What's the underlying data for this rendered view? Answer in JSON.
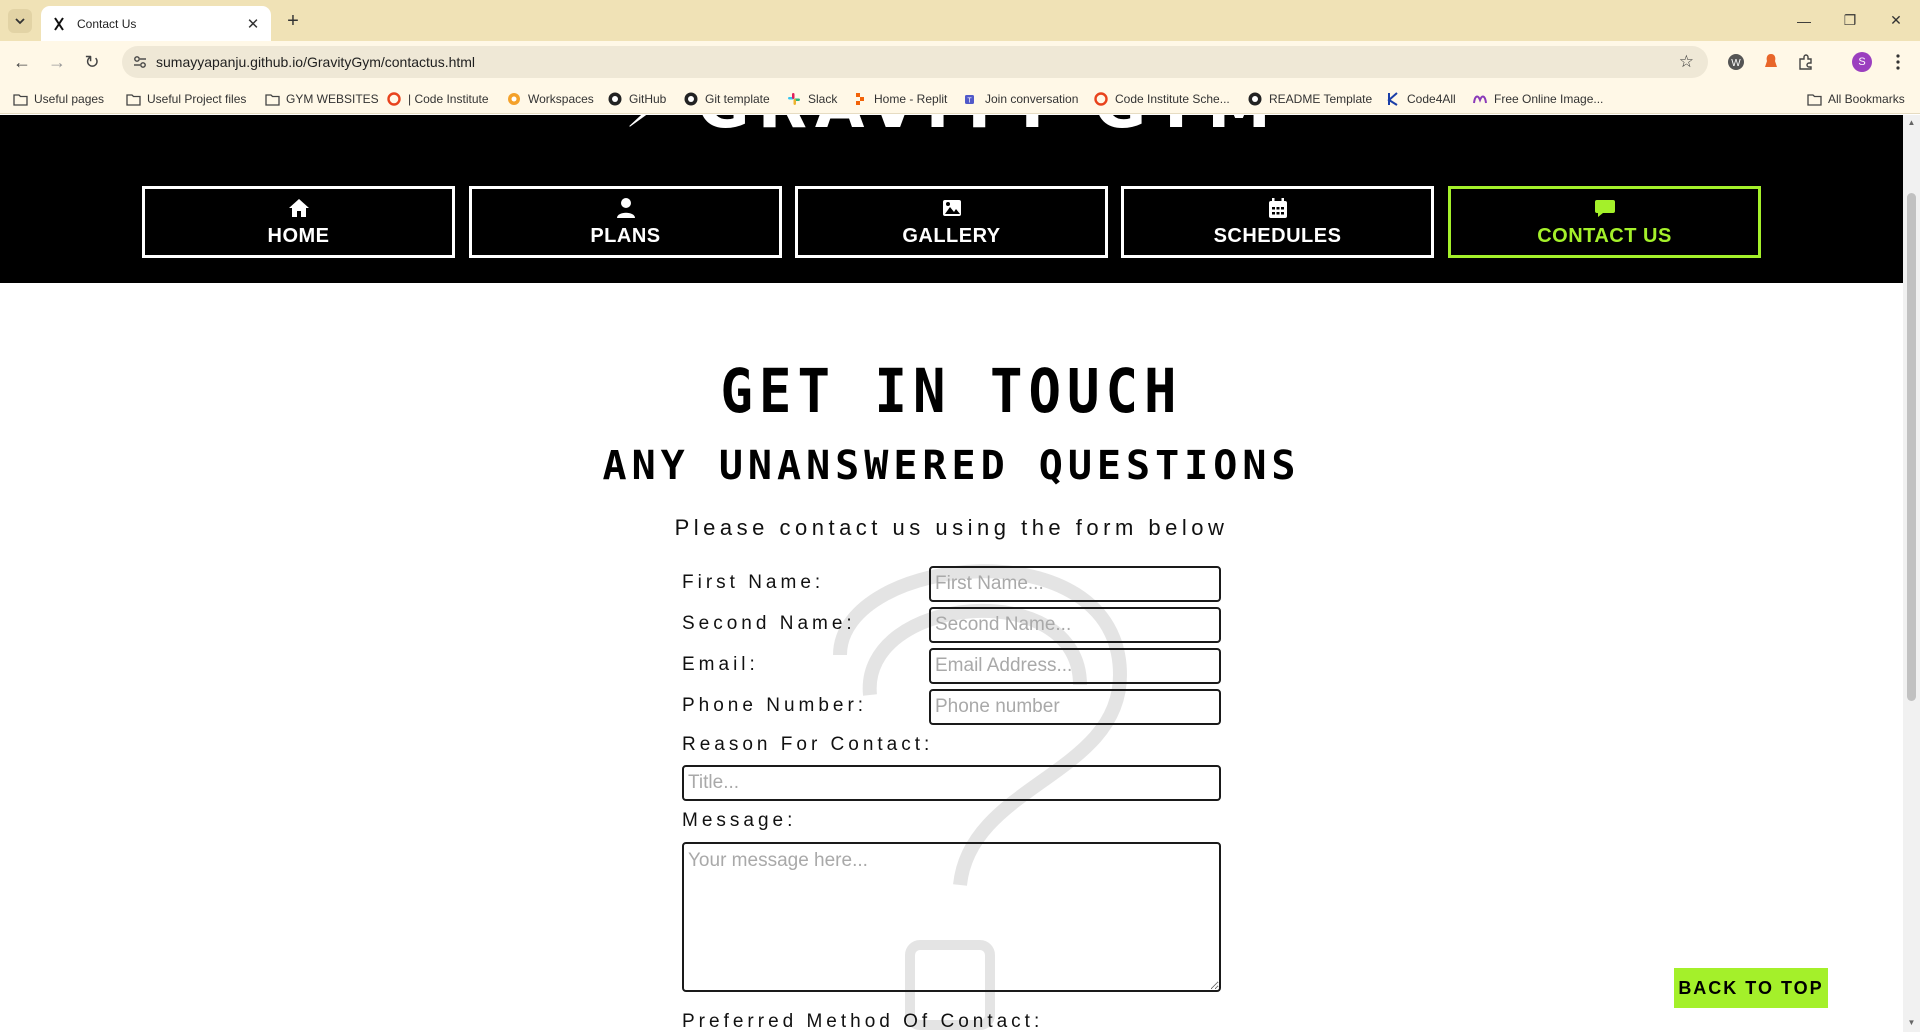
{
  "browser": {
    "tab_title": "Contact Us",
    "url": "sumayyapanju.github.io/GravityGym/contactus.html",
    "profile_initial": "S",
    "bookmarks": [
      {
        "label": "Useful pages",
        "icon": "folder-icon"
      },
      {
        "label": "Useful Project files",
        "icon": "folder-icon"
      },
      {
        "label": "GYM WEBSITES",
        "icon": "folder-icon"
      },
      {
        "label": "| Code Institute",
        "icon": "code-institute-icon"
      },
      {
        "label": "Workspaces",
        "icon": "workspaces-icon"
      },
      {
        "label": "GitHub",
        "icon": "github-icon"
      },
      {
        "label": "Git template",
        "icon": "github-icon"
      },
      {
        "label": "Slack",
        "icon": "slack-icon"
      },
      {
        "label": "Home - Replit",
        "icon": "replit-icon"
      },
      {
        "label": "Join conversation",
        "icon": "teams-icon"
      },
      {
        "label": "Code Institute Sche...",
        "icon": "code-institute-icon"
      },
      {
        "label": "README Template",
        "icon": "github-icon"
      },
      {
        "label": "Code4All",
        "icon": "k-icon"
      },
      {
        "label": "Free Online Image...",
        "icon": "meta-icon"
      }
    ],
    "all_bookmarks": "All Bookmarks"
  },
  "site": {
    "logo_text": "GRAVITY GYM",
    "nav": [
      {
        "label": "HOME",
        "icon": "home-icon"
      },
      {
        "label": "PLANS",
        "icon": "user-icon"
      },
      {
        "label": "GALLERY",
        "icon": "image-icon"
      },
      {
        "label": "SCHEDULES",
        "icon": "calendar-icon"
      },
      {
        "label": "CONTACT US",
        "icon": "chat-icon",
        "active": true
      }
    ],
    "accent_color": "#a4f02a"
  },
  "contact": {
    "heading": "GET IN TOUCH",
    "subheading": "ANY UNANSWERED QUESTIONS",
    "lead": "Please contact us using the form below",
    "first_name_label": "First Name:",
    "first_name_placeholder": "First Name...",
    "second_name_label": "Second Name:",
    "second_name_placeholder": "Second Name...",
    "email_label": "Email:",
    "email_placeholder": "Email Address...",
    "phone_label": "Phone Number:",
    "phone_placeholder": "Phone number",
    "reason_label": "Reason For Contact:",
    "reason_placeholder": "Title...",
    "message_label": "Message:",
    "message_placeholder": "Your message here...",
    "preferred_label": "Preferred Method Of Contact:"
  },
  "back_to_top": "BACK TO TOP"
}
